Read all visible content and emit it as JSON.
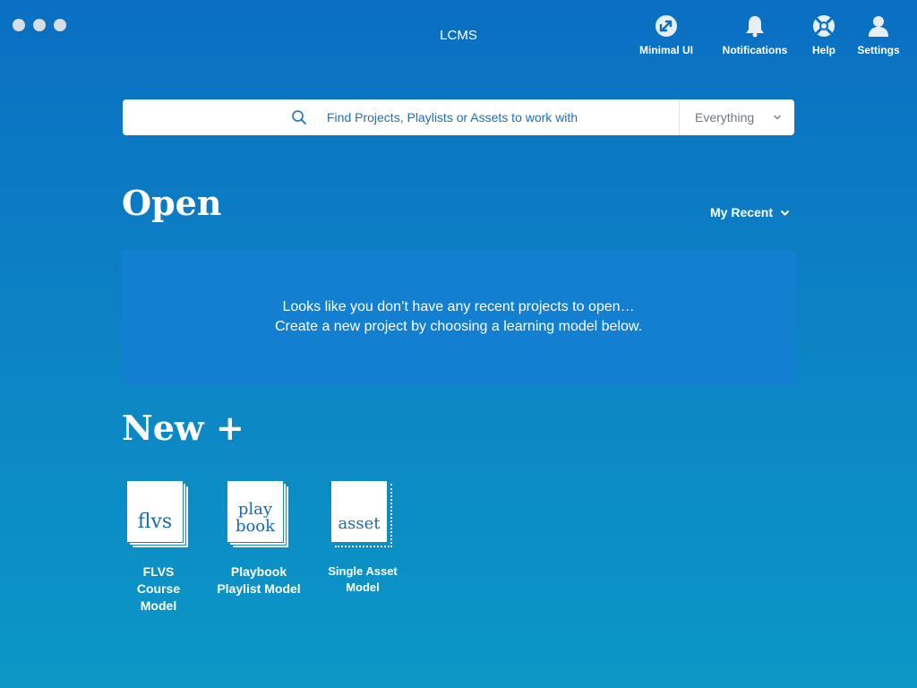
{
  "window": {
    "title": "LCMS"
  },
  "toolbar": {
    "items": [
      {
        "label": "Minimal UI",
        "icon": "minimal-ui-icon"
      },
      {
        "label": "Notifications",
        "icon": "bell-icon"
      },
      {
        "label": "Help",
        "icon": "lifebuoy-icon"
      },
      {
        "label": "Settings",
        "icon": "user-icon"
      }
    ]
  },
  "search": {
    "placeholder": "Find Projects, Playlists or Assets to work with",
    "value": "",
    "scope": "Everything"
  },
  "open_section": {
    "heading": "Open",
    "filter": "My Recent",
    "empty_line1": "Looks like you don’t have any recent projects to open…",
    "empty_line2": "Create a new project by choosing a learning model below."
  },
  "new_section": {
    "heading": "New +",
    "models": [
      {
        "icon_text": "flvs",
        "label_line1": "FLVS Course",
        "label_line2": "Model"
      },
      {
        "icon_text_line1": "play",
        "icon_text_line2": "book",
        "label_line1": "Playbook",
        "label_line2": "Playlist Model"
      },
      {
        "icon_text": "asset",
        "label_line1": "Single Asset",
        "label_line2": "Model"
      }
    ]
  },
  "colors": {
    "accent": "#1a68ae",
    "background_top": "#0a6fc2",
    "background_bottom": "#0b97c6"
  }
}
